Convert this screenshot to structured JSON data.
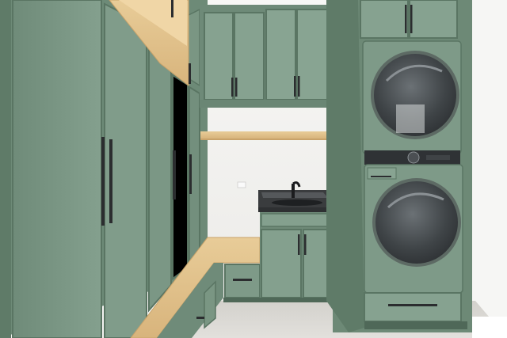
{
  "scene": {
    "palette": {
      "cabinet": "#7e9a88",
      "cabinet_dark": "#5f7a69",
      "cabinet_light": "#93ad9c",
      "wall": "#f2f2f0",
      "wood": "#e6c792",
      "floor": "#d8d6d1",
      "counter": "#3a3c3e",
      "hardware": "#2b2d2f",
      "washer_door": "#3d4144"
    }
  }
}
